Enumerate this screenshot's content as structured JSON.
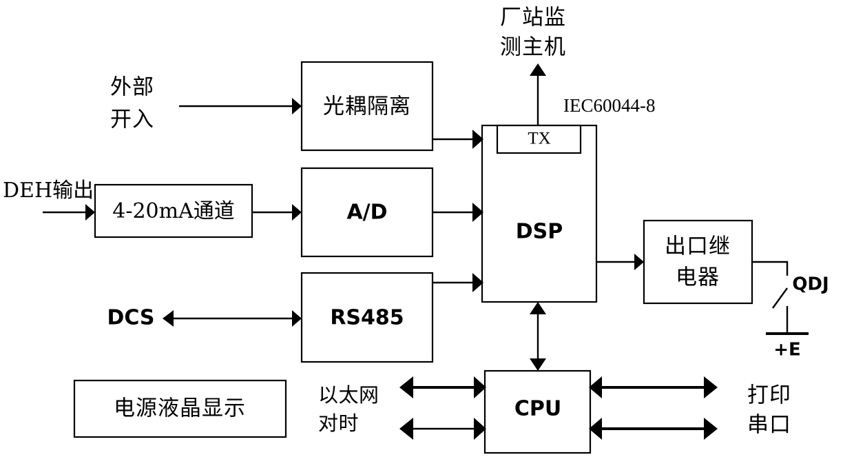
{
  "diagram": {
    "title": "Device block diagram",
    "colors": {
      "line": "#000000",
      "fill": "#ffffff",
      "text": "#000000"
    },
    "blocks": {
      "optocoupler": {
        "label": "光耦隔离"
      },
      "ad": {
        "label": "A/D"
      },
      "channel_420ma": {
        "label": "4-20mA通道"
      },
      "rs485": {
        "label": "RS485"
      },
      "dsp": {
        "label": "DSP"
      },
      "tx": {
        "label": "TX"
      },
      "relay": {
        "label_line1": "出口继",
        "label_line2": "电器"
      },
      "cpu": {
        "label": "CPU"
      },
      "power_lcd": {
        "label": "电源液晶显示"
      }
    },
    "labels": {
      "external_input_line1": "外部",
      "external_input_line2": "开入",
      "deh_output": "DEH输出",
      "dcs": "DCS",
      "monitor_host_line1": "厂站监",
      "monitor_host_line2": "测主机",
      "iec_standard": "IEC60044-8",
      "qdj": "QDJ",
      "plus_e": "+E",
      "ethernet_line1": "以太网",
      "ethernet_line2": "对时",
      "print": "打印",
      "serial_port": "串口"
    }
  }
}
